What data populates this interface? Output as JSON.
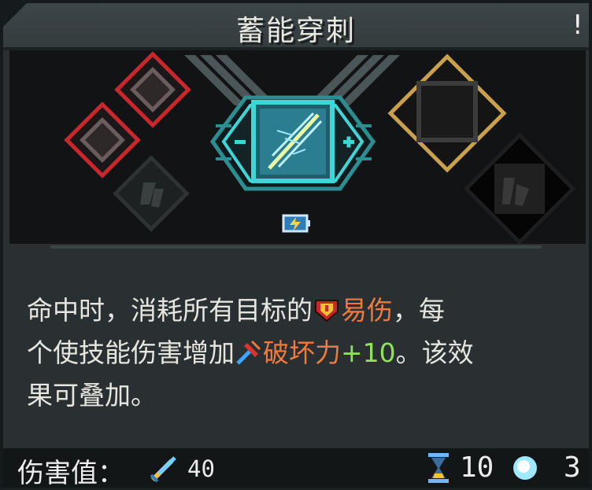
{
  "title": "蓄能穿刺",
  "title_mark": "!",
  "description": {
    "line1_prefix": "命中时，消耗所有目标的",
    "keyword_vulnerable": "易伤",
    "line1_suffix": "，每",
    "line2_prefix": "个使技能伤害增加",
    "keyword_destruction": "破坏力",
    "bonus": "+10",
    "line2_suffix": "。该效",
    "line3": "果可叠加。"
  },
  "footer": {
    "damage_label": "伤害值：",
    "damage_value": "40",
    "cooldown_value": "10",
    "cost_value": "3"
  },
  "icons": {
    "vulnerable": "shield-icon",
    "destruction": "hammer-icon",
    "damage": "sword-icon",
    "cooldown": "hourglass-icon",
    "cost": "orb-icon",
    "energy": "battery-lightning-icon",
    "skill": "spear-lightning-icon"
  },
  "colors": {
    "accent_cyan": "#3ed6d6",
    "locked_red": "#c9272b",
    "upgrade_gold": "#c9a14a",
    "keyword_orange": "#f07a3e",
    "bonus_green": "#8fe45a"
  }
}
